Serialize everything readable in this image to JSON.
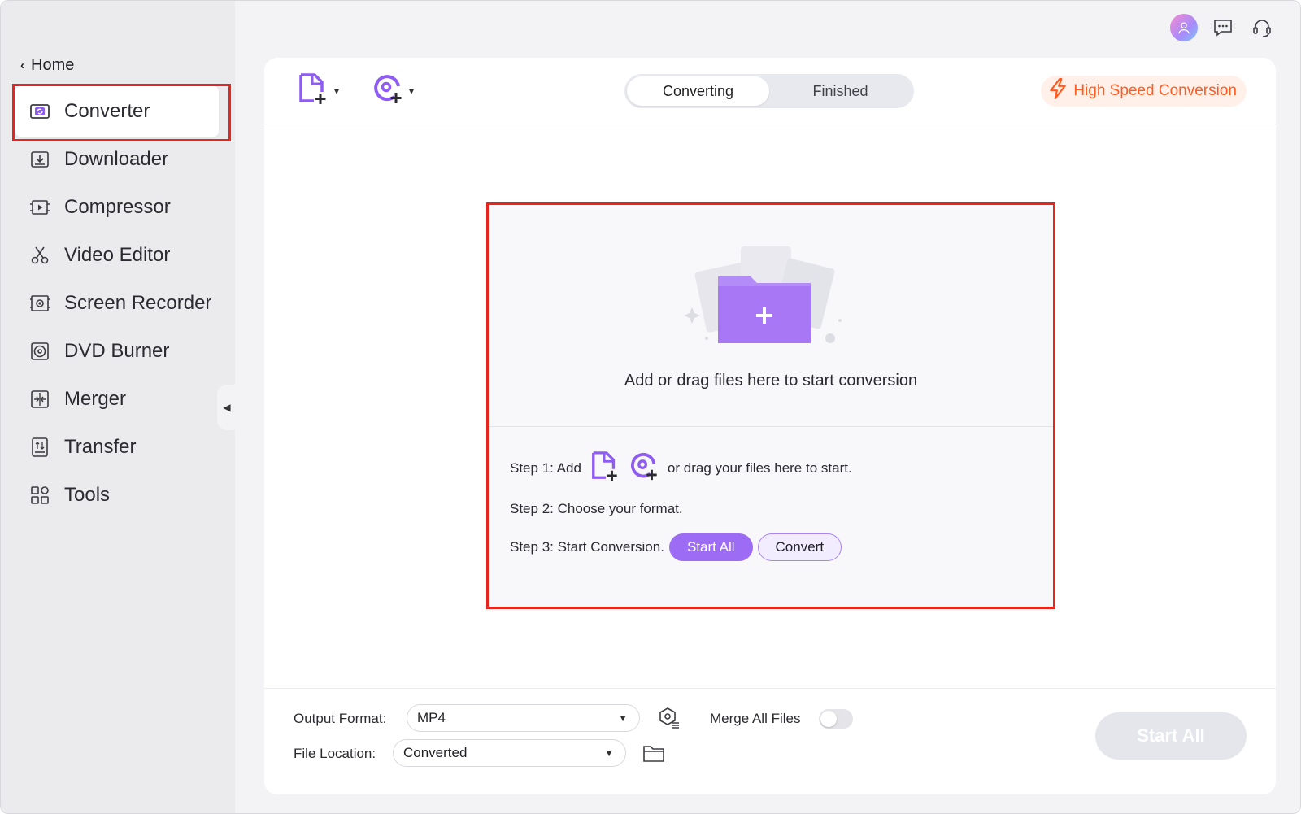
{
  "sidebar": {
    "home_label": "Home",
    "items": [
      {
        "label": "Converter",
        "icon": "converter-icon",
        "active": true
      },
      {
        "label": "Downloader",
        "icon": "downloader-icon"
      },
      {
        "label": "Compressor",
        "icon": "compressor-icon"
      },
      {
        "label": "Video Editor",
        "icon": "scissors-icon"
      },
      {
        "label": "Screen Recorder",
        "icon": "screen-recorder-icon"
      },
      {
        "label": "DVD Burner",
        "icon": "disc-icon"
      },
      {
        "label": "Merger",
        "icon": "merger-icon"
      },
      {
        "label": "Transfer",
        "icon": "transfer-icon"
      },
      {
        "label": "Tools",
        "icon": "tools-grid-icon"
      }
    ]
  },
  "toolbar": {
    "tabs": [
      {
        "label": "Converting",
        "active": true
      },
      {
        "label": "Finished",
        "active": false
      }
    ],
    "high_speed_label": "High Speed Conversion"
  },
  "dropzone": {
    "headline": "Add or drag files here to start conversion",
    "step1_prefix": "Step 1: Add",
    "step1_suffix": "or drag your files here to start.",
    "step2": "Step 2: Choose your format.",
    "step3": "Step 3: Start Conversion.",
    "start_all_label": "Start  All",
    "convert_label": "Convert"
  },
  "footer": {
    "output_format_label": "Output Format:",
    "output_format_value": "MP4",
    "file_location_label": "File Location:",
    "file_location_value": "Converted",
    "merge_label": "Merge All Files",
    "merge_enabled": false,
    "start_all_label": "Start All"
  },
  "colors": {
    "accent": "#9c6cf5",
    "highlight_outline": "#e5251f",
    "high_speed": "#ff5a1f"
  }
}
